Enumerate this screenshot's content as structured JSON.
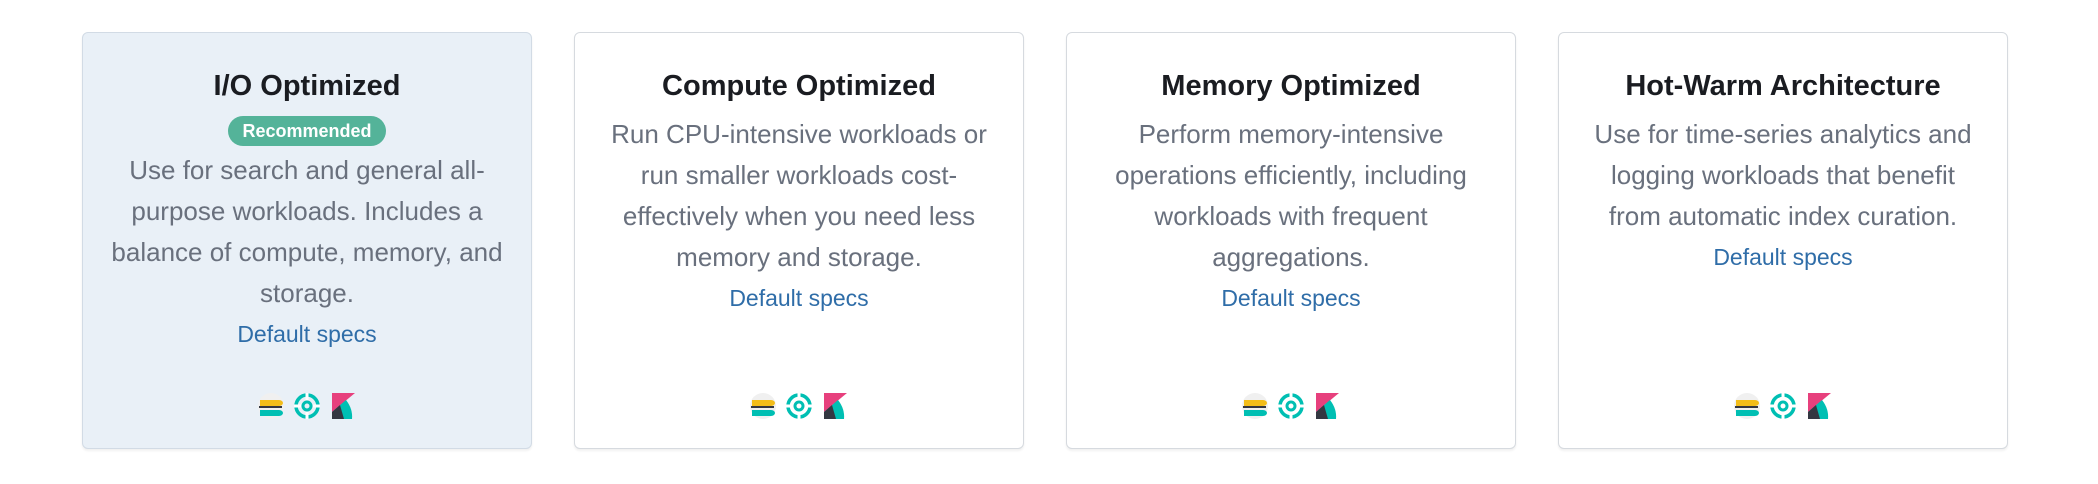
{
  "cards": [
    {
      "title": "I/O Optimized",
      "badge": "Recommended",
      "description": "Use for search and general all-purpose workloads. Includes a balance of compute, memory, and storage.",
      "link": "Default specs",
      "icons": [
        "elasticsearch-icon",
        "apm-icon",
        "kibana-icon"
      ],
      "selected": true
    },
    {
      "title": "Compute Optimized",
      "description": "Run CPU-intensive workloads or run smaller workloads cost-effectively when you need less memory and storage.",
      "link": "Default specs",
      "icons": [
        "elasticsearch-icon",
        "apm-icon",
        "kibana-icon"
      ]
    },
    {
      "title": "Memory Optimized",
      "description": "Perform memory-intensive operations efficiently, including workloads with frequent aggregations.",
      "link": "Default specs",
      "icons": [
        "elasticsearch-icon",
        "apm-icon",
        "kibana-icon"
      ]
    },
    {
      "title": "Hot-Warm Architecture",
      "description": "Use for time-series analytics and logging workloads that benefit from automatic index curation.",
      "link": "Default specs",
      "icons": [
        "elasticsearch-icon",
        "apm-icon",
        "kibana-icon"
      ]
    }
  ],
  "colors": {
    "selected_bg": "#e9f0f7",
    "badge": "#54b399",
    "link": "#2f6da8",
    "text": "#69707d",
    "title": "#1a1c21"
  }
}
